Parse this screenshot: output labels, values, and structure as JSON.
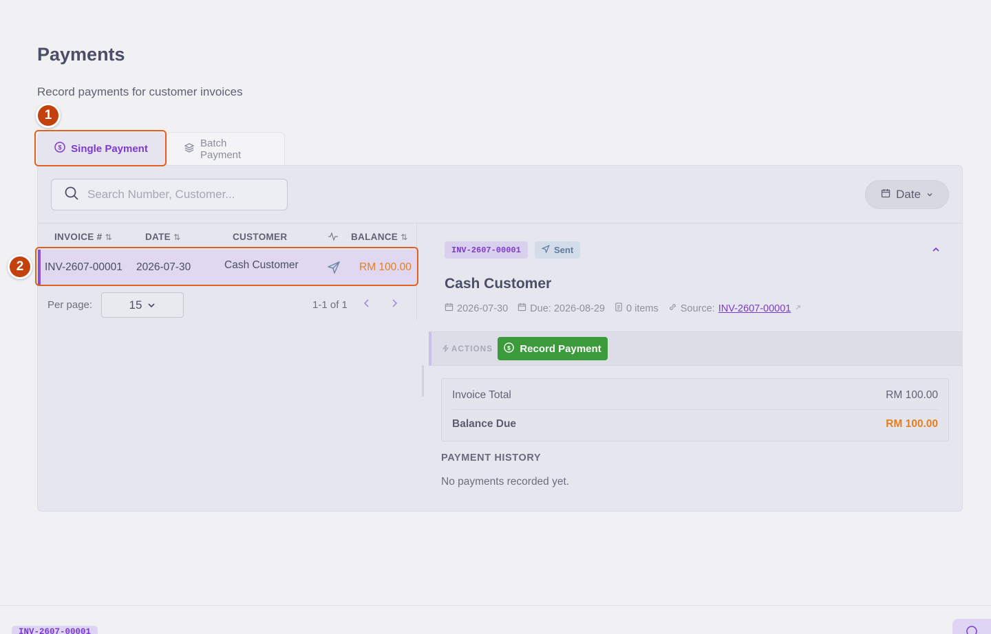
{
  "page": {
    "title": "Payments",
    "subtitle": "Record payments for customer invoices"
  },
  "annotations": [
    "1",
    "2"
  ],
  "tabs": [
    {
      "label": "Single Payment",
      "icon": "dollar-circle-icon",
      "active": true
    },
    {
      "label": "Batch Payment",
      "icon": "layers-icon",
      "active": false
    }
  ],
  "search": {
    "placeholder": "Search Number, Customer..."
  },
  "date_filter": {
    "label": "Date"
  },
  "table": {
    "headers": [
      "INVOICE #",
      "DATE",
      "CUSTOMER",
      "",
      "BALANCE"
    ],
    "rows": [
      {
        "invoice": "INV-2607-00001",
        "date": "2026-07-30",
        "customer": "Cash Customer",
        "status_icon": "send-icon",
        "balance": "RM 100.00"
      }
    ]
  },
  "pagination": {
    "per_page_label": "Per page:",
    "per_page_value": "15",
    "range": "1-1 of 1"
  },
  "detail": {
    "invoice_number": "INV-2607-00001",
    "status": "Sent",
    "customer_name": "Cash Customer",
    "date": "2026-07-30",
    "due": "Due: 2026-08-29",
    "items": "0 items",
    "source_label": "Source:",
    "source_link": "INV-2607-00001",
    "actions_label": "ACTIONS",
    "record_payment_label": "Record Payment",
    "invoice_total_label": "Invoice Total",
    "invoice_total_value": "RM 100.00",
    "balance_due_label": "Balance Due",
    "balance_due_value": "RM 100.00",
    "payment_history_title": "PAYMENT HISTORY",
    "payment_history_empty": "No payments recorded yet."
  },
  "footer": {
    "badge": "INV-2607-00001"
  },
  "colors": {
    "accent": "#7c3acd",
    "success": "#3b9b3b",
    "balance": "#e67e22",
    "annotation": "#c2410c"
  }
}
